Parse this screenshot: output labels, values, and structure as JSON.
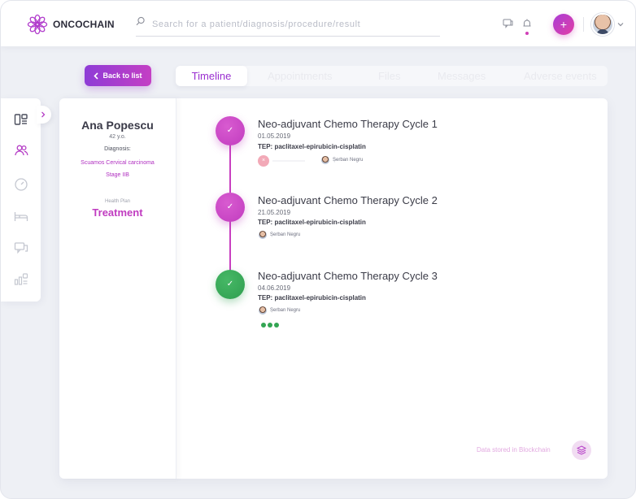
{
  "header": {
    "brand": "ONCOCHAIN",
    "search_placeholder": "Search for a patient/diagnosis/procedure/result",
    "add_label": "+"
  },
  "nav": {
    "back_label": "Back to list",
    "tabs": [
      {
        "label": "Timeline",
        "active": true
      },
      {
        "label": "Appointments",
        "active": false
      },
      {
        "label": "Files",
        "active": false
      },
      {
        "label": "Messages",
        "active": false
      },
      {
        "label": "Adverse events",
        "active": false
      }
    ]
  },
  "rail": {
    "icons": [
      "dashboard-icon",
      "patients-icon",
      "gauge-icon",
      "bed-icon",
      "chat-icon",
      "stats-icon"
    ]
  },
  "patient": {
    "name": "Ana Popescu",
    "age": "42 y.o.",
    "diagnosis_label": "Diagnosis:",
    "diagnosis": "Scuamos Cervical carcinoma",
    "stage": "Stage IIB",
    "plan_label": "Health Plan",
    "plan": "Treatment"
  },
  "timeline": {
    "items": [
      {
        "title": "Neo-adjuvant Chemo Therapy Cycle 1",
        "date": "01.05.2019",
        "tep": "TEP: paclitaxel-epirubicin-cisplatin",
        "doctor": "Șerban Negru",
        "status": "done",
        "status_mark": "×"
      },
      {
        "title": "Neo-adjuvant Chemo Therapy Cycle 2",
        "date": "21.05.2019",
        "tep": "TEP: paclitaxel-epirubicin-cisplatin",
        "doctor": "Șerban Negru",
        "status": "done"
      },
      {
        "title": "Neo-adjuvant Chemo Therapy Cycle 3",
        "date": "04.06.2019",
        "tep": "TEP: paclitaxel-epirubicin-cisplatin",
        "doctor": "Șerban Negru",
        "status": "in-progress"
      }
    ],
    "check_mark": "✓"
  },
  "footer": {
    "blockchain_label": "Data stored in Blockchain"
  },
  "colors": {
    "accent": "#c13cbf",
    "accent_dark": "#8e3bd6",
    "success": "#2f9e4f"
  }
}
